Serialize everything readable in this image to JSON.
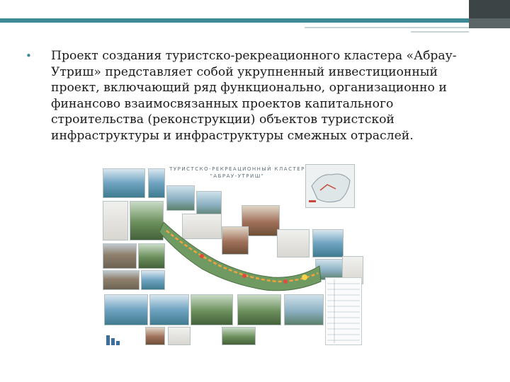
{
  "body": {
    "paragraph": "Проект создания туристско-рекреационного кластера «Абрау-Утриш» представляет собой укрупненный инвестиционный проект, включающий ряд функционально, организационно и финансово взаимосвязанных проектов капитального строительства (реконструкции) объектов туристской инфраструктуры и инфраструктуры смежных отраслей.",
    "bullet": "•"
  },
  "collage": {
    "title_line1": "ТУРИСТСКО-РЕКРЕАЦИОННЫЙ КЛАСТЕР",
    "title_line2": "\"АБРАУ-УТРИШ\""
  },
  "colors": {
    "accent_teal": "#3e8a94",
    "header_dark": "#3c4446",
    "route_orange": "#f2a23a",
    "coast_green": "#6f9a62"
  }
}
